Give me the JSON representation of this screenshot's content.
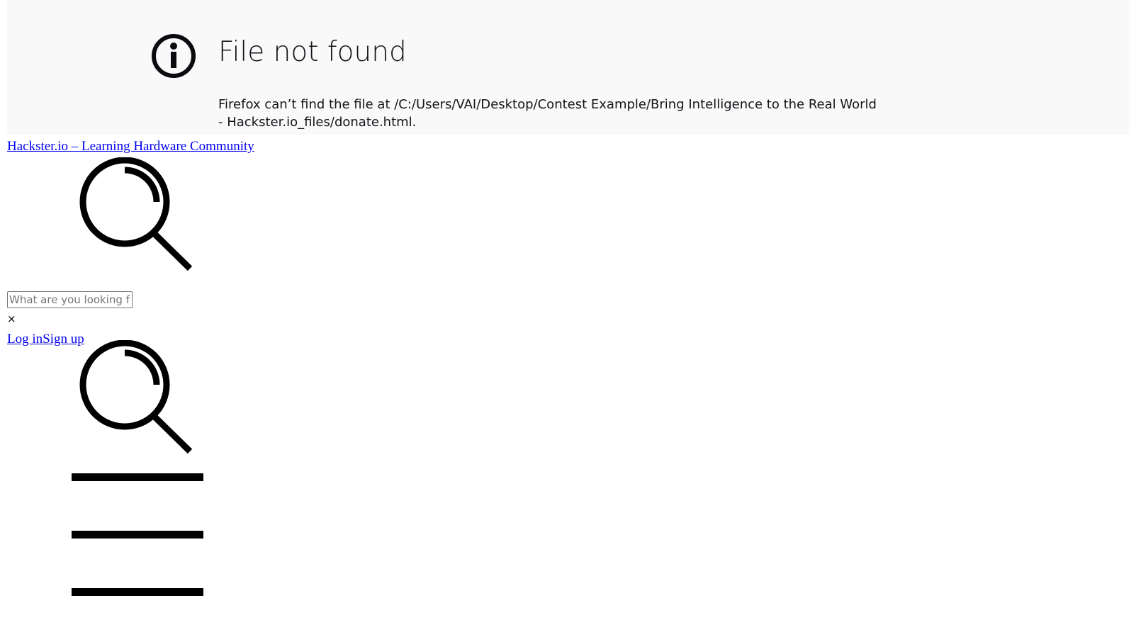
{
  "error_page": {
    "title": "File not found",
    "description": "Firefox can’t find the file at /C:/Users/VAI/Desktop/Contest Example/Bring Intelligence to the Real World - Hackster.io_files/donate.html.",
    "icon": "info-icon"
  },
  "site": {
    "home_link": "Hackster.io – Learning Hardware Community"
  },
  "search": {
    "placeholder": "What are you looking for?",
    "value": "",
    "close_label": "×",
    "icon": "search-icon"
  },
  "auth": {
    "login": "Log in",
    "signup": "Sign up"
  },
  "nav": {
    "search_icon": "search-icon",
    "menu_icon": "hamburger-menu-icon"
  },
  "colors": {
    "link": "#0000ee",
    "error_panel_bg": "#f9f9fa",
    "text": "#15141a"
  }
}
